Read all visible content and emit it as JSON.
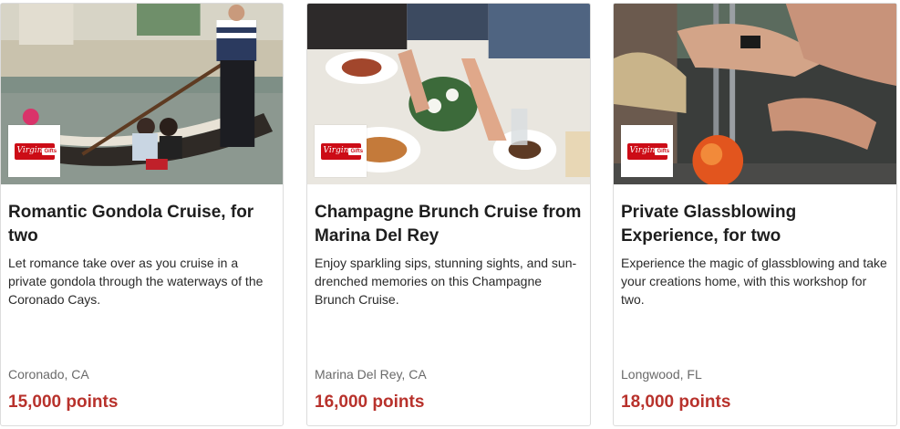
{
  "brand": {
    "logo_text": "Virgin",
    "logo_tag": "Gifts",
    "color": "#cc0c16"
  },
  "accent_color": "#b8322c",
  "cards": [
    {
      "title": "Romantic Gondola Cruise, for two",
      "description": "Let romance take over as you cruise in a private gondola through the waterways of the Coronado Cays.",
      "location": "Coronado, CA",
      "points": "15,000 points",
      "image_icon": "gondola-photo"
    },
    {
      "title": "Champagne Brunch Cruise from Marina Del Rey",
      "description": "Enjoy sparkling sips, stunning sights, and sun-drenched memories on this Champagne Brunch Cruise.",
      "location": "Marina Del Rey, CA",
      "points": "16,000 points",
      "image_icon": "brunch-photo"
    },
    {
      "title": "Private Glassblowing Experience, for two",
      "description": "Experience the magic of glassblowing and take your creations home, with this workshop for two.",
      "location": "Longwood, FL",
      "points": "18,000 points",
      "image_icon": "glassblowing-photo"
    }
  ]
}
